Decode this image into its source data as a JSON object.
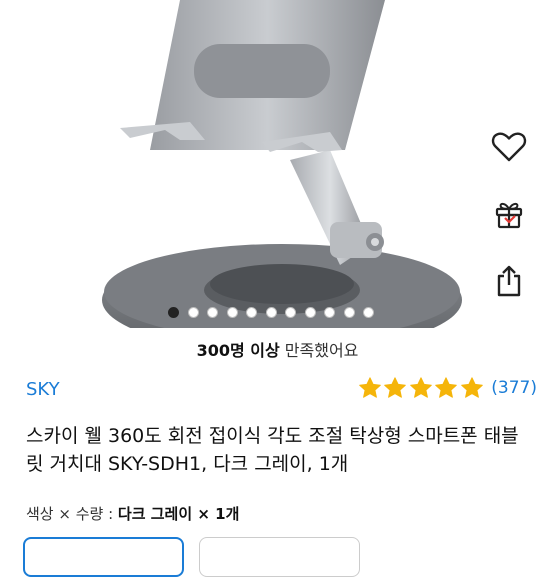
{
  "product": {
    "satisfaction_count": "300명 이상",
    "satisfaction_suffix": " 만족했어요",
    "brand": "SKY",
    "rating_count": "(377)",
    "rating_stars": 5,
    "title": "스카이 웰 360도 회전 접이식 각도 조절 탁상형 스마트폰 태블릿 거치대 SKY-SDH1, 다크 그레이, 1개",
    "option_label": "색상 × 수량 : ",
    "option_value": "다크 그레이 × 1개"
  },
  "carousel": {
    "total": 11,
    "active_index": 0
  },
  "actions": [
    {
      "icon": "heart-icon",
      "label": "wishlist"
    },
    {
      "icon": "gift-icon",
      "label": "gift"
    },
    {
      "icon": "share-icon",
      "label": "share"
    }
  ],
  "colors": {
    "accent": "#1a7cd6",
    "star": "#f5b50a"
  }
}
